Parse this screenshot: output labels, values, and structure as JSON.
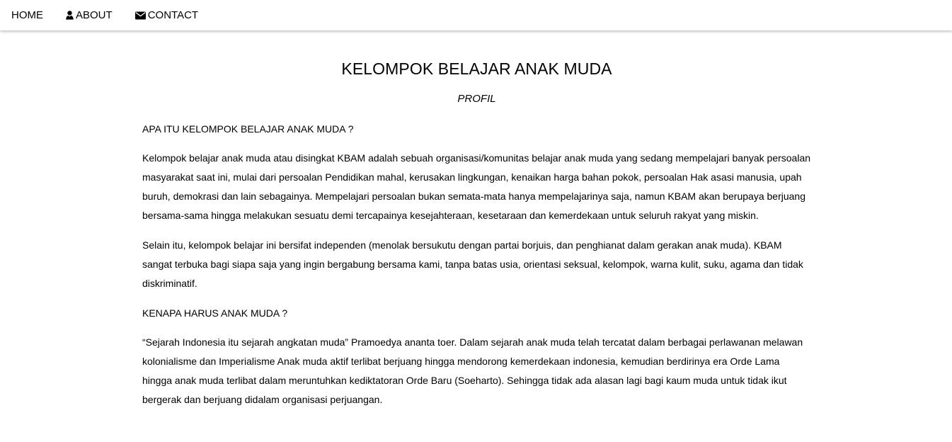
{
  "nav": {
    "home_label": "HOME",
    "about_label": "ABOUT",
    "contact_label": "CONTACT",
    "about_icon": "user-icon",
    "contact_icon": "envelope-icon"
  },
  "main": {
    "title": "KELOMPOK BELAJAR ANAK MUDA",
    "subtitle": "PROFIL",
    "question1": "APA ITU KELOMPOK BELAJAR ANAK MUDA ?",
    "paragraph1": "Kelompok belajar anak muda atau disingkat KBAM adalah sebuah organisasi/komunitas belajar anak muda yang sedang mempelajari banyak persoalan masyarakat saat ini, mulai dari persoalan Pendidikan mahal, kerusakan lingkungan, kenaikan harga bahan pokok, persoalan Hak asasi manusia, upah buruh, demokrasi dan lain sebagainya. Mempelajari persoalan bukan semata-mata hanya mempelajarinya saja, namun KBAM akan berupaya berjuang bersama-sama hingga melakukan sesuatu demi tercapainya kesejahteraan, kesetaraan dan kemerdekaan untuk seluruh rakyat yang miskin.",
    "paragraph2": "Selain itu, kelompok belajar ini bersifat independen (menolak bersukutu dengan partai borjuis, dan penghianat dalam gerakan anak muda). KBAM sangat terbuka bagi siapa saja yang ingin bergabung bersama kami, tanpa batas usia, orientasi seksual, kelompok, warna kulit, suku, agama dan tidak diskriminatif.",
    "question2": "KENAPA HARUS ANAK MUDA ?",
    "paragraph3": "“Sejarah Indonesia itu sejarah angkatan muda” Pramoedya ananta toer. Dalam sejarah anak muda telah tercatat dalam berbagai perlawanan melawan kolonialisme dan Imperialisme Anak muda aktif terlibat berjuang hingga mendorong kemerdekaan indonesia, kemudian berdirinya era Orde Lama hingga anak muda terlibat dalam meruntuhkan kediktatoran Orde Baru (Soeharto). Sehingga tidak ada alasan lagi bagi kaum muda untuk tidak ikut bergerak dan berjuang didalam organisasi perjuangan."
  }
}
